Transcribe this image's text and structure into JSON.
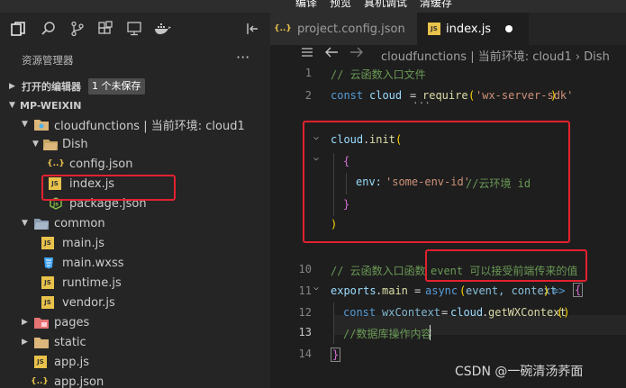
{
  "menubar": {
    "items": [
      "编译",
      "预览",
      "真机调试",
      "清缓存"
    ]
  },
  "toolbar": {
    "icons": [
      "files-icon",
      "search-icon",
      "source-control-icon",
      "extensions-icon",
      "debug-icon",
      "docker-icon",
      "collapse-panel-icon"
    ]
  },
  "sidebar": {
    "title": "资源管理器",
    "more": "···",
    "open_editors": {
      "label": "打开的编辑器",
      "badge": "1 个未保存"
    },
    "project": {
      "label": "MP-WEIXIN"
    },
    "tree": [
      {
        "label": "cloudfunctions | 当前环境: cloud1",
        "type": "folder"
      },
      {
        "label": "Dish",
        "type": "folder"
      },
      {
        "label": "config.json",
        "type": "json"
      },
      {
        "label": "index.js",
        "type": "js"
      },
      {
        "label": "package.json",
        "type": "npm"
      },
      {
        "label": "common",
        "type": "folder"
      },
      {
        "label": "main.js",
        "type": "js"
      },
      {
        "label": "main.wxss",
        "type": "css"
      },
      {
        "label": "runtime.js",
        "type": "js"
      },
      {
        "label": "vendor.js",
        "type": "js"
      },
      {
        "label": "pages",
        "type": "folder-special"
      },
      {
        "label": "static",
        "type": "folder"
      },
      {
        "label": "app.js",
        "type": "js"
      },
      {
        "label": "app.json",
        "type": "json"
      }
    ]
  },
  "tabs": [
    {
      "label": "project.config.json",
      "icon": "{..}"
    },
    {
      "label": "index.js",
      "icon": "JS"
    }
  ],
  "breadcrumb": "cloudfunctions | 当前环境: cloud1 › Dish",
  "editor": {
    "lines": {
      "l1_comment": "// 云函数入口文件",
      "l2_const": "const",
      "l2_var": "cloud",
      "l2_eq": "=",
      "l2_fn": "require",
      "l2_str": "'wx-server-sdk'",
      "l4_obj": "cloud",
      "l4_fn": "init",
      "l6_key": "env:",
      "l6_str": "'some-env-id'",
      "l6_comment": "//云环境 id",
      "l10_comment": "// 云函数入口函数",
      "l10_comment2": "event 可以接受前端传来的值",
      "l11_obj": "exports",
      "l11_prop": "main",
      "l11_async": "async",
      "l11_params": "event, context",
      "l12_const": "const",
      "l12_var": "wxContext",
      "l12_obj": "cloud",
      "l12_fn": "getWXContext",
      "l13_comment": "//数据库操作内容"
    },
    "line_numbers": {
      "l1": "1",
      "l2": "2",
      "l10": "10",
      "l11": "11",
      "l12": "12",
      "l13": "13",
      "l14": "14"
    }
  },
  "watermark": "CSDN @一碗清汤荞面"
}
